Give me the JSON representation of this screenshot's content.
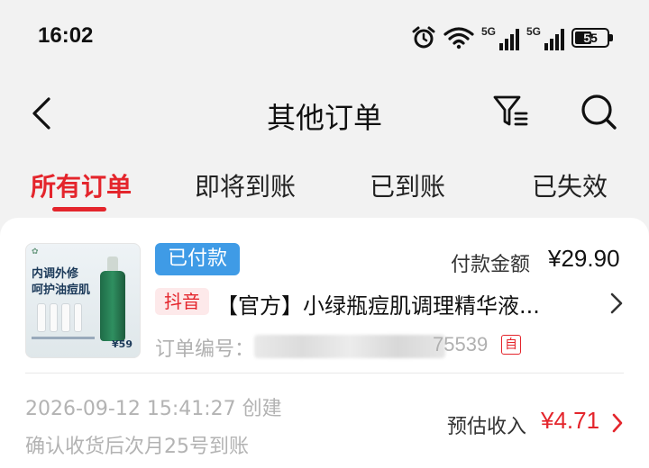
{
  "status_bar": {
    "time": "16:02",
    "signal1_label": "5G",
    "signal2_label": "5G",
    "battery": "55"
  },
  "nav": {
    "title": "其他订单"
  },
  "tabs": [
    {
      "label": "所有订单",
      "active": true
    },
    {
      "label": "即将到账",
      "active": false
    },
    {
      "label": "已到账",
      "active": false
    },
    {
      "label": "已失效",
      "active": false
    }
  ],
  "order": {
    "status": "已付款",
    "amount_label": "付款金额",
    "amount": "¥29.90",
    "platform": "抖音",
    "title": "【官方】小绿瓶痘肌调理精华液...",
    "order_no_label": "订单编号：",
    "order_no_tail": "75539",
    "self_badge": "自",
    "created": "2026-09-12 15:41:27 创建",
    "settle_note": "确认收货后次月25号到账",
    "est_label": "预估收入",
    "est_amount": "¥4.71",
    "thumb": {
      "line1": "内调外修",
      "line2": "呵护油痘肌",
      "price": "¥59"
    }
  },
  "colors": {
    "accent": "#e4252c",
    "badge_blue": "#3f9be6"
  }
}
